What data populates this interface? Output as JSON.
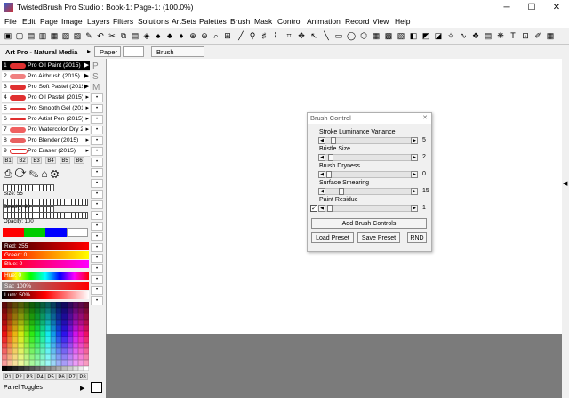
{
  "window": {
    "title": "TwistedBrush Pro Studio : Book-1: Page-1:  (100.0%)",
    "minimize": "─",
    "maximize": "☐",
    "close": "✕"
  },
  "menu": [
    "File",
    "Edit",
    "Page",
    "Image",
    "Layers",
    "Filters",
    "Solutions",
    "ArtSets",
    "Palettes",
    "Brush",
    "Mask",
    "Control",
    "Animation",
    "Record",
    "View",
    "Help"
  ],
  "toolbar2": {
    "paper_label": "Paper",
    "brush_label": "Brush"
  },
  "brush_panel": {
    "set_name": "Art Pro - Natural Media (2015)",
    "side_letters": [
      "P",
      "S",
      "M"
    ],
    "brushes": [
      {
        "num": "1",
        "name": "Pro Oil Paint (2015)"
      },
      {
        "num": "2",
        "name": "Pro Airbrush (2015)"
      },
      {
        "num": "3",
        "name": "Pro Soft Pastel (2015)"
      },
      {
        "num": "4",
        "name": "Pro Oil Pastel (2015)"
      },
      {
        "num": "5",
        "name": "Pro Smooth Gel (2015)"
      },
      {
        "num": "6",
        "name": "Pro Artist Pen (2015)"
      },
      {
        "num": "7",
        "name": "Pro Watercolor Dry 2"
      },
      {
        "num": "8",
        "name": "Pro Blender (2015)"
      },
      {
        "num": "9",
        "name": "Pro Eraser (2015)"
      }
    ],
    "banks": [
      "B1",
      "B2",
      "B3",
      "B4",
      "B5",
      "B6"
    ],
    "size_label": "Size: 55",
    "density_label": "Density: 80",
    "opacity_label": "Opacity: 100"
  },
  "color_panel": {
    "red": "Red: 255",
    "green": "Green: 0",
    "blue": "Blue: 0",
    "hue": "Hue: 0",
    "sat": "Sat: 100%",
    "lum": "Lum: 50%",
    "palette_tabs": [
      "P1",
      "P2",
      "P3",
      "P4",
      "P5",
      "P6",
      "P7",
      "P8"
    ],
    "footer": "Panel Toggles",
    "current_color": "#ff0000"
  },
  "brush_control": {
    "title": "Brush Control",
    "close": "✕",
    "params": [
      {
        "label": "Stroke Luminance Variance",
        "value": "5",
        "level": 0.05
      },
      {
        "label": "Bristle Size",
        "value": "2",
        "level": 0.02
      },
      {
        "label": "Brush Dryness",
        "value": "0",
        "level": 0.0
      },
      {
        "label": "Surface Smearing",
        "value": "15",
        "level": 0.15
      },
      {
        "label": "Paint Residue",
        "value": "1",
        "level": 0.01
      }
    ],
    "checkbox_mark": "✓",
    "add_button": "Add Brush Controls",
    "load_button": "Load Preset",
    "save_button": "Save Preset",
    "rnd_button": "RND"
  },
  "colors": {
    "canvas": "#ffffff",
    "workspace": "#7b7b7b",
    "accent_red": "#e03030"
  }
}
